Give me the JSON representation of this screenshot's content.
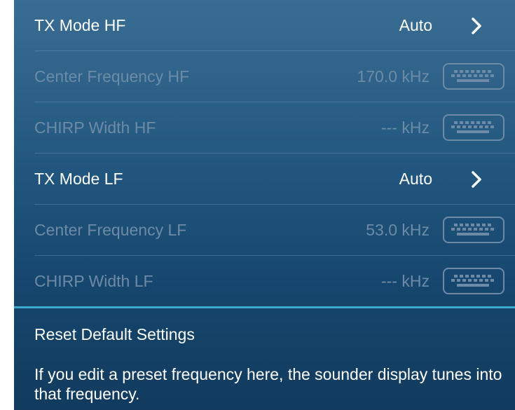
{
  "settings": {
    "rows": [
      {
        "label": "TX Mode HF",
        "value": "Auto",
        "control": "chevron-right-icon",
        "enabled": true
      },
      {
        "label": "Center Frequency HF",
        "value": "170.0 kHz",
        "control": "keyboard-icon",
        "enabled": false
      },
      {
        "label": "CHIRP Width HF",
        "value": "--- kHz",
        "control": "keyboard-icon",
        "enabled": false
      },
      {
        "label": "TX Mode LF",
        "value": "Auto",
        "control": "chevron-right-icon",
        "enabled": true
      },
      {
        "label": "Center Frequency LF",
        "value": "53.0 kHz",
        "control": "keyboard-icon",
        "enabled": false
      },
      {
        "label": "CHIRP Width LF",
        "value": "--- kHz",
        "control": "keyboard-icon",
        "enabled": false
      }
    ],
    "reset_label": "Reset Default Settings",
    "help_text": "If you edit a preset frequency here, the sounder display tunes into that frequency."
  },
  "colors": {
    "enabled_text": "#ffffff",
    "disabled_text": "#6d8ba6",
    "accent_line": "#3fa8cf",
    "background_top": "#3a6d93",
    "background_bottom": "#123b5e"
  }
}
